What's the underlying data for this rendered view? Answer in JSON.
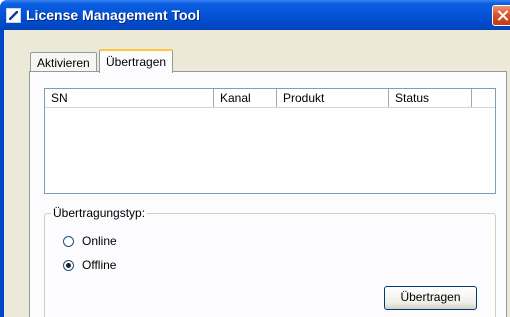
{
  "window": {
    "title": "License Management Tool"
  },
  "tabs": [
    {
      "label": "Aktivieren",
      "active": false
    },
    {
      "label": "Übertragen",
      "active": true
    }
  ],
  "list": {
    "columns": [
      "SN",
      "Kanal",
      "Produkt",
      "Status"
    ],
    "rows": []
  },
  "transfer_group": {
    "label": "Übertragungstyp:",
    "options": [
      {
        "label": "Online",
        "selected": false
      },
      {
        "label": "Offline",
        "selected": true
      }
    ],
    "button_label": "Übertragen"
  },
  "colors": {
    "titlebar": "#0554d8",
    "client_background": "#ece9d8",
    "panel_background": "#fcfcfe",
    "close_button": "#d8502a"
  }
}
